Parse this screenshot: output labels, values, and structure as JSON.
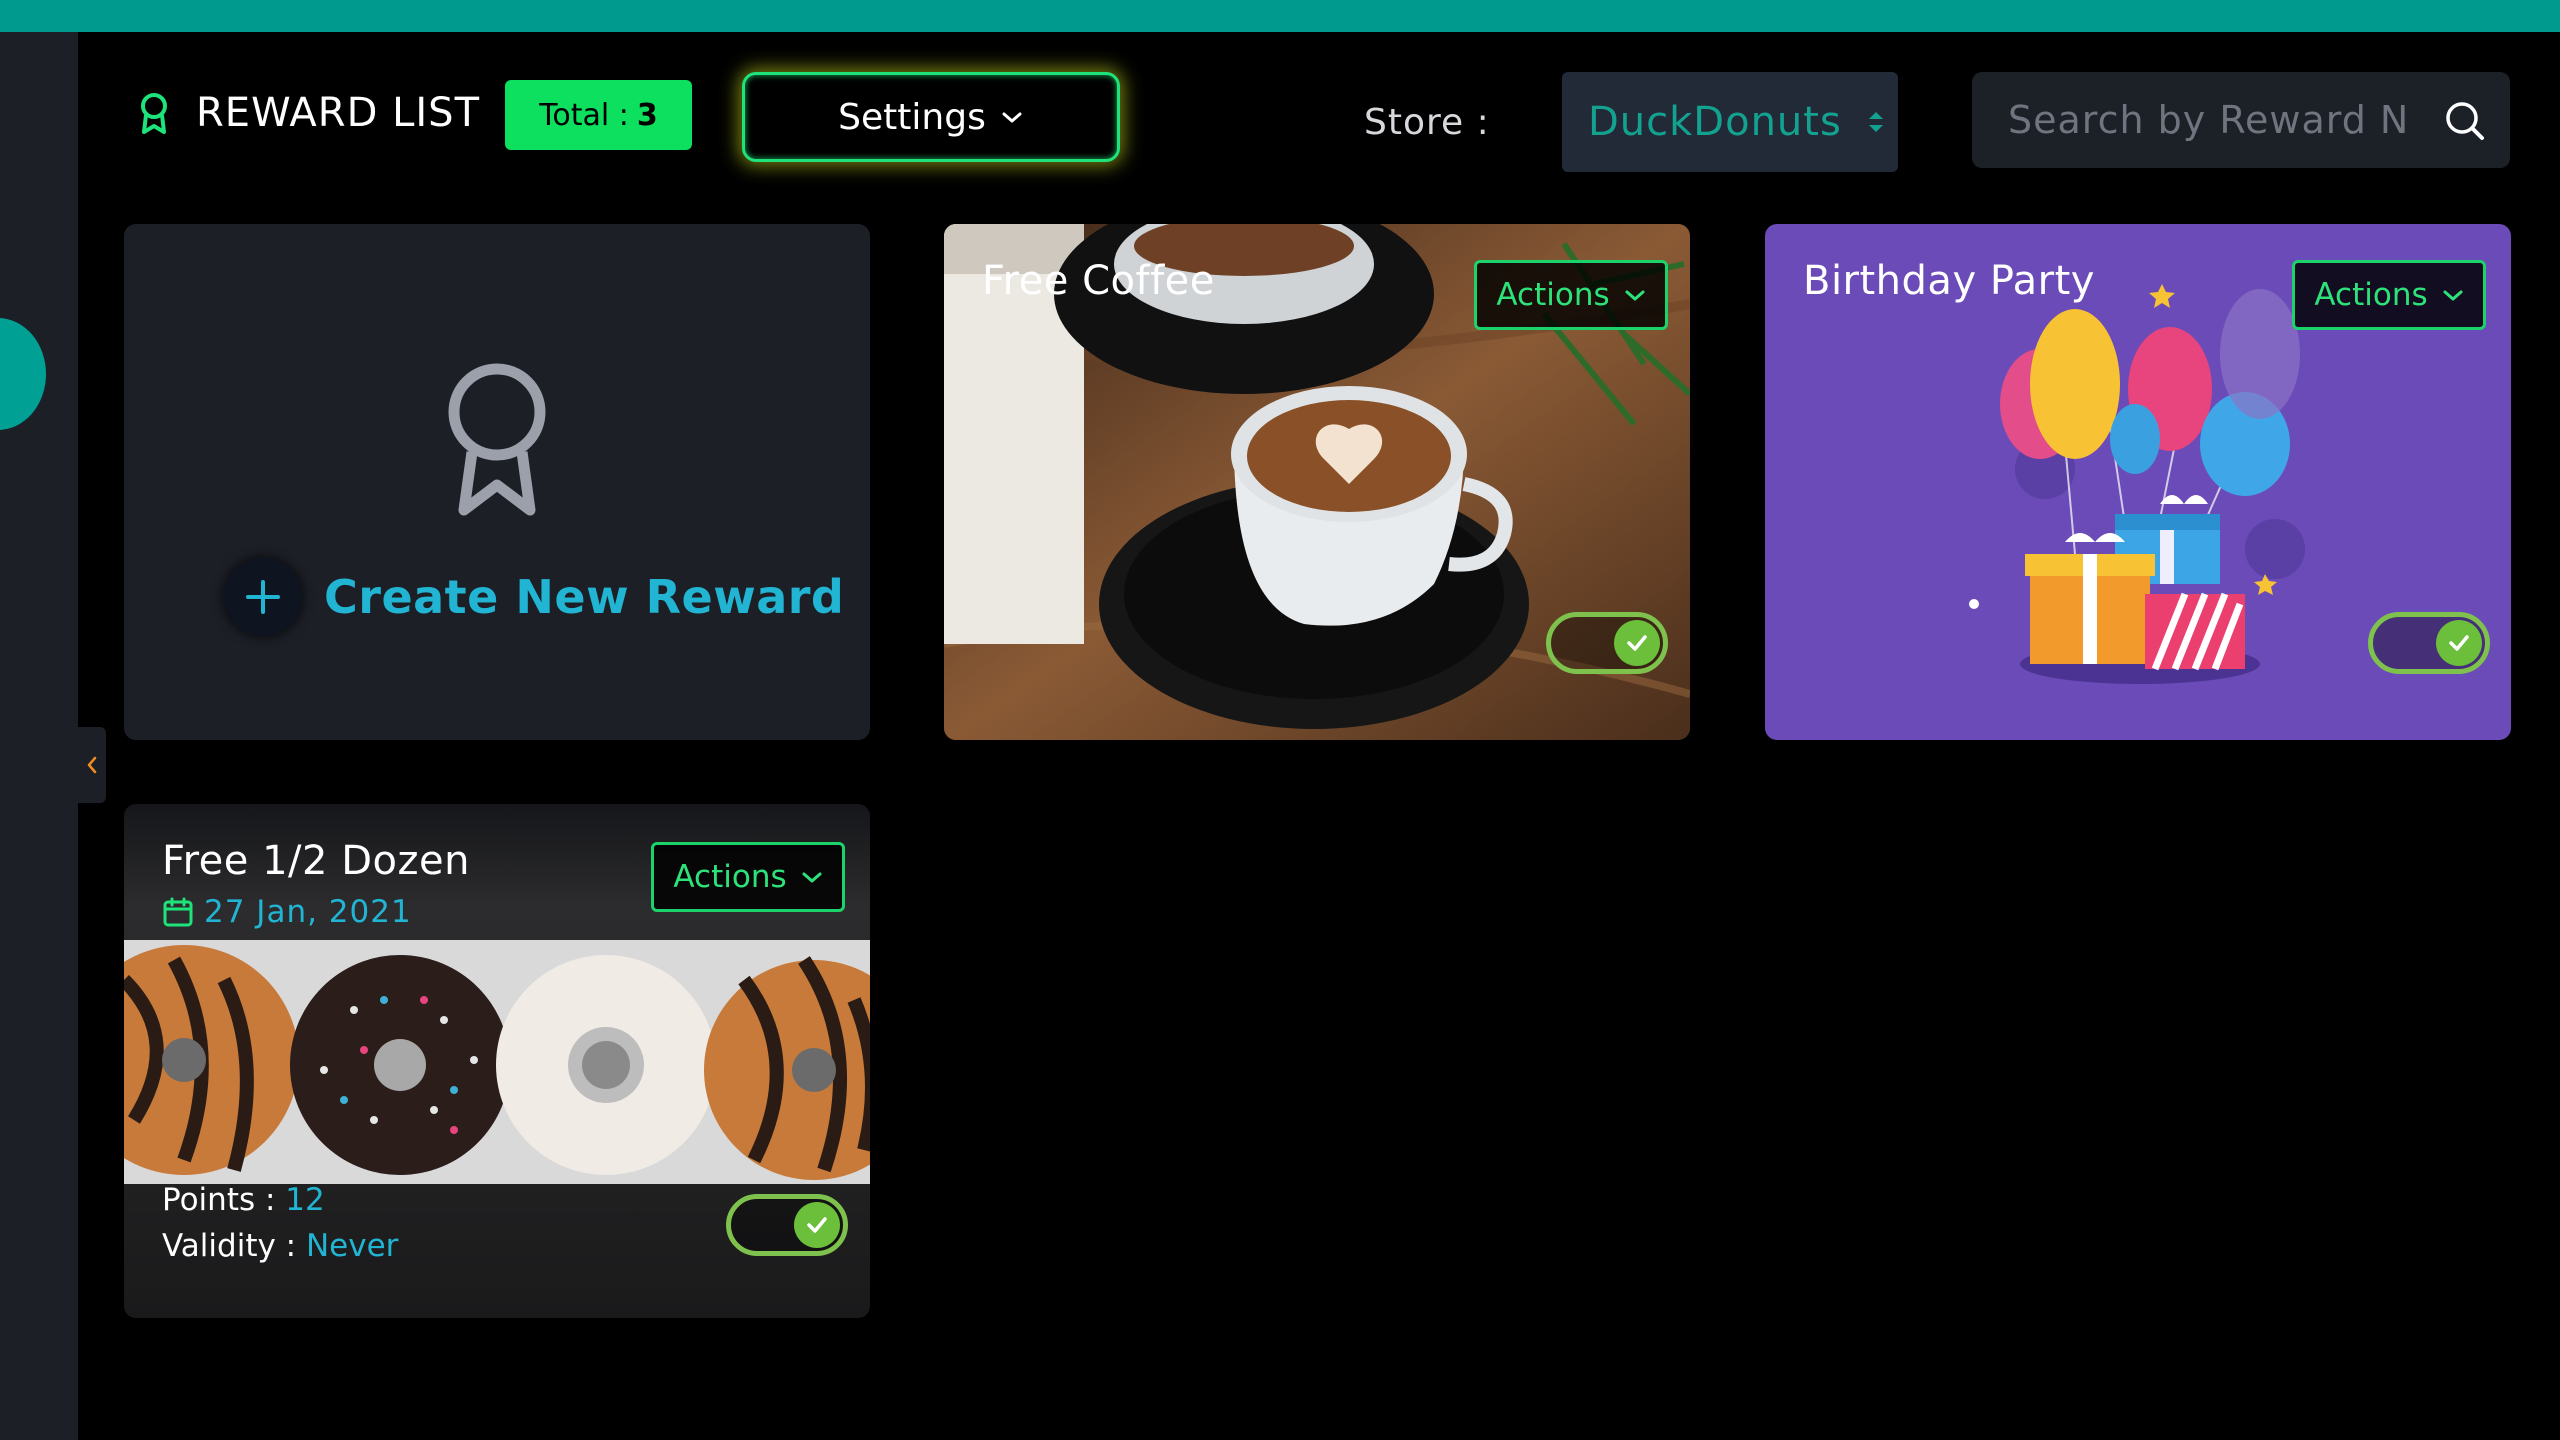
{
  "header": {
    "title": "REWARD LIST",
    "total_label": "Total :",
    "total_count": "3",
    "settings_label": "Settings",
    "store_label": "Store :",
    "store_value": "DuckDonuts",
    "search_placeholder": "Search by Reward N"
  },
  "create_card": {
    "label": "Create New Reward"
  },
  "rewards": [
    {
      "title": "Free Coffee",
      "actions_label": "Actions",
      "enabled": true
    },
    {
      "title": "Birthday Party",
      "actions_label": "Actions",
      "enabled": true
    },
    {
      "title": "Free 1/2 Dozen",
      "date": "27 Jan, 2021",
      "actions_label": "Actions",
      "points_label": "Points :",
      "points_value": "12",
      "validity_label": "Validity :",
      "validity_value": "Never",
      "enabled": true
    }
  ],
  "icons": {
    "header": "award-icon",
    "settings": "chevron-down-icon",
    "store": "sort-arrows-icon",
    "search": "search-icon",
    "create": "plus-icon",
    "toggle": "check-icon",
    "date": "calendar-icon",
    "sidebar": "chevron-left-icon"
  },
  "colors": {
    "accent": "#009a8e",
    "success": "#0ddf5e",
    "link": "#21b5d3",
    "party_card": "#6b4bb7"
  }
}
